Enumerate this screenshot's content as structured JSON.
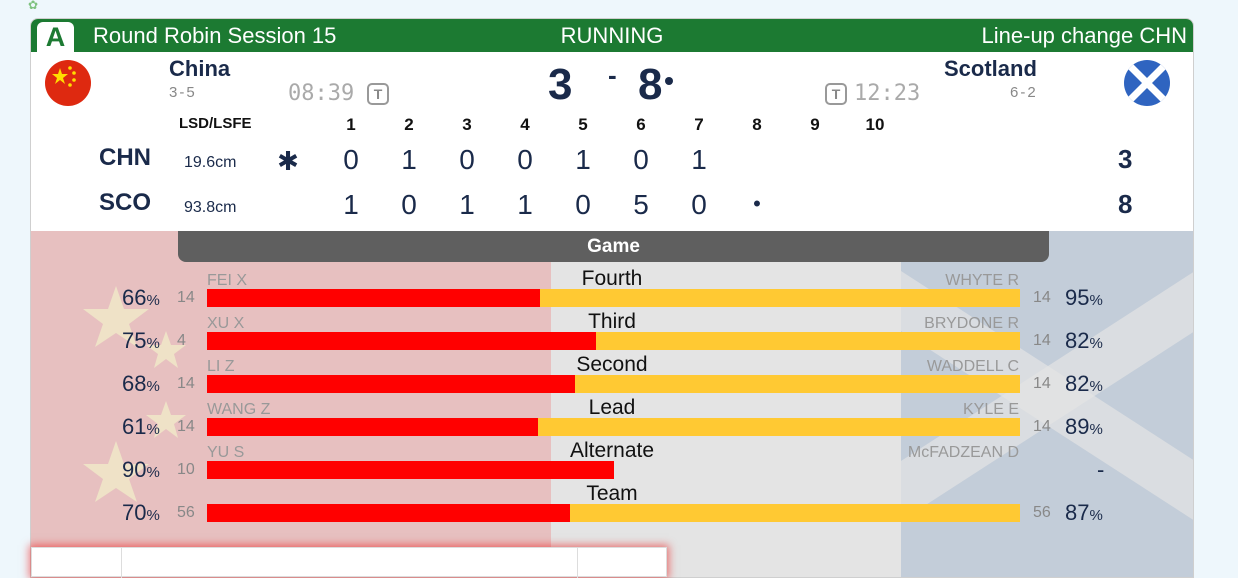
{
  "header": {
    "pool": "A",
    "session": "Round Robin Session 15",
    "status": "RUNNING",
    "lineup": "Line-up change CHN"
  },
  "teams": {
    "left": {
      "name": "China",
      "record": "3-5",
      "clock": "08:39",
      "score": "3",
      "abbr": "CHN",
      "lsd": "19.6cm",
      "total": "3",
      "flag": "china-flag"
    },
    "right": {
      "name": "Scotland",
      "record": "6-2",
      "clock": "12:23",
      "score": "8",
      "abbr": "SCO",
      "lsd": "93.8cm",
      "total": "8",
      "flag": "scotland-flag"
    },
    "separator": "-",
    "timeout_label": "T"
  },
  "ends": {
    "lsd_header": "LSD/LSFE",
    "end_numbers": [
      "1",
      "2",
      "3",
      "4",
      "5",
      "6",
      "7",
      "8",
      "9",
      "10"
    ],
    "chn_marker": "✱",
    "chn_scores": [
      "0",
      "1",
      "0",
      "0",
      "1",
      "0",
      "1",
      "",
      "",
      ""
    ],
    "sco_scores": [
      "1",
      "0",
      "1",
      "1",
      "0",
      "5",
      "0",
      "•",
      "",
      ""
    ]
  },
  "stats": {
    "tab_label": "Game",
    "rows": [
      {
        "position": "Fourth",
        "left_name": "FEI X",
        "right_name": "WHYTE R",
        "left_pct": "66",
        "left_shots": "14",
        "right_pct": "95",
        "right_shots": "14",
        "left_share": 0.41
      },
      {
        "position": "Third",
        "left_name": "XU X",
        "right_name": "BRYDONE R",
        "left_pct": "75",
        "left_shots": "4",
        "right_pct": "82",
        "right_shots": "14",
        "left_share": 0.478
      },
      {
        "position": "Second",
        "left_name": "LI Z",
        "right_name": "WADDELL C",
        "left_pct": "68",
        "left_shots": "14",
        "right_pct": "82",
        "right_shots": "14",
        "left_share": 0.453
      },
      {
        "position": "Lead",
        "left_name": "WANG Z",
        "right_name": "KYLE E",
        "left_pct": "61",
        "left_shots": "14",
        "right_pct": "89",
        "right_shots": "14",
        "left_share": 0.407
      },
      {
        "position": "Alternate",
        "left_name": "YU S",
        "right_name": "McFADZEAN D",
        "left_pct": "90",
        "left_shots": "10",
        "right_pct": "-",
        "right_shots": "",
        "left_share": 0.5,
        "right_share": 0
      },
      {
        "position": "Team",
        "left_name": "",
        "right_name": "",
        "left_pct": "70",
        "left_shots": "56",
        "right_pct": "87",
        "right_shots": "56",
        "left_share": 0.446
      }
    ],
    "pct_sign": "%",
    "colors": {
      "left": "#ff0000",
      "right": "#ffc933"
    },
    "carousel_active_index": 2
  }
}
